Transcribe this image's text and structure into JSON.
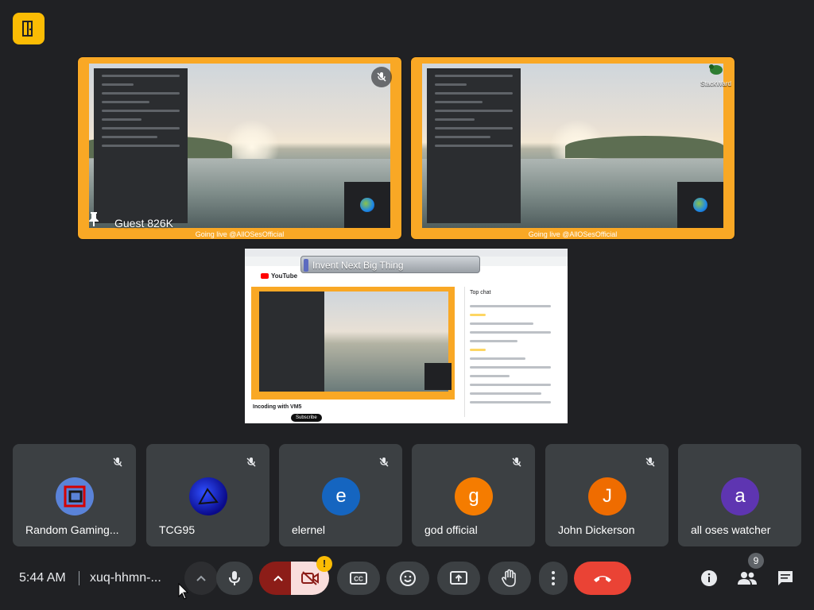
{
  "app": {
    "logo_icon": "door-exit-icon"
  },
  "tiles": [
    {
      "name": "Guest 826K",
      "stream_banner": "Going live @AllOSesOfficial",
      "pinned": true,
      "muted": true
    },
    {
      "name": "",
      "stream_banner": "Going live @AllOSesOfficial",
      "corner_label": "StackWard",
      "muted": false
    }
  ],
  "presentation": {
    "overlay_title": "Invent Next Big Thing",
    "site": "YouTube",
    "video_title": "Incoding with VM5",
    "subscribe": "Subscribe",
    "chat_header": "Top chat"
  },
  "participants": [
    {
      "name": "Random Gaming...",
      "initial": "",
      "avatar_color": "#5a83d9",
      "avatar_icon": "red-square-logo-icon"
    },
    {
      "name": "TCG95",
      "initial": "",
      "avatar_color": "#1a1aa8",
      "avatar_icon": "blue-abstract-icon"
    },
    {
      "name": "elernel",
      "initial": "e",
      "avatar_color": "#1565c0"
    },
    {
      "name": "god official",
      "initial": "g",
      "avatar_color": "#f57c00"
    },
    {
      "name": "John Dickerson",
      "initial": "J",
      "avatar_color": "#ef6c00"
    },
    {
      "name": "all oses watcher",
      "initial": "a",
      "avatar_color": "#5e35b1"
    }
  ],
  "bottom_bar": {
    "time": "5:44 AM",
    "meeting_code": "xuq-hhmn-...",
    "camera_warning": "!",
    "people_count": "9"
  },
  "colors": {
    "background": "#202124",
    "tile_border": "#f9a825",
    "leave": "#ea4335",
    "camera_off": "#f9dedc"
  }
}
